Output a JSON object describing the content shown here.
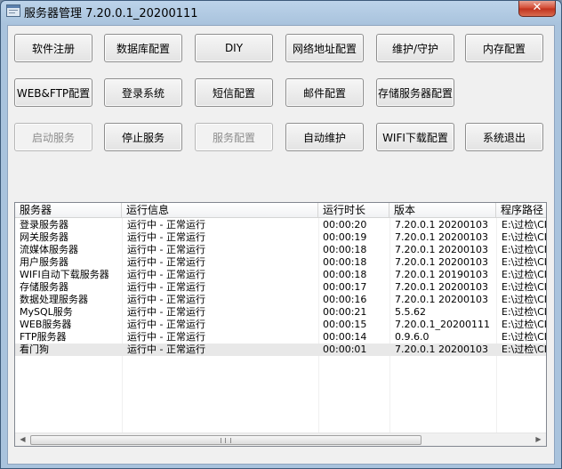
{
  "window": {
    "title": "服务器管理 7.20.0.1_20200111",
    "close_symbol": "✕",
    "icon": "app-window-icon"
  },
  "buttons": {
    "row1": [
      "软件注册",
      "数据库配置",
      "DIY",
      "网络地址配置",
      "维护/守护",
      "内存配置"
    ],
    "row2": [
      "WEB&FTP配置",
      "登录系统",
      "短信配置",
      "邮件配置",
      "存储服务器配置"
    ],
    "row3": [
      "启动服务",
      "停止服务",
      "服务配置",
      "自动维护",
      "WIFI下载配置",
      "系统退出"
    ]
  },
  "list": {
    "columns": [
      "服务器",
      "运行信息",
      "运行时长",
      "版本",
      "程序路径"
    ],
    "rows": [
      [
        "登录服务器",
        "运行中 - 正常运行",
        "00:00:20",
        "7.20.0.1 20200103",
        "E:\\过检\\CI"
      ],
      [
        "网关服务器",
        "运行中 - 正常运行",
        "00:00:19",
        "7.20.0.1 20200103",
        "E:\\过检\\CI"
      ],
      [
        "流媒体服务器",
        "运行中 - 正常运行",
        "00:00:18",
        "7.20.0.1 20200103",
        "E:\\过检\\CI"
      ],
      [
        "用户服务器",
        "运行中 - 正常运行",
        "00:00:18",
        "7.20.0.1 20200103",
        "E:\\过检\\CI"
      ],
      [
        "WIFI自动下载服务器",
        "运行中 - 正常运行",
        "00:00:18",
        "7.20.0.1 20190103",
        "E:\\过检\\CI"
      ],
      [
        "存储服务器",
        "运行中 - 正常运行",
        "00:00:17",
        "7.20.0.1 20200103",
        "E:\\过检\\CI"
      ],
      [
        "数据处理服务器",
        "运行中 - 正常运行",
        "00:00:16",
        "7.20.0.1 20200103",
        "E:\\过检\\CI"
      ],
      [
        "MySQL服务",
        "运行中 - 正常运行",
        "00:00:21",
        "5.5.62",
        "E:\\过检\\CI"
      ],
      [
        "WEB服务器",
        "运行中 - 正常运行",
        "00:00:15",
        "7.20.0.1_20200111",
        "E:\\过检\\CI"
      ],
      [
        "FTP服务器",
        "运行中 - 正常运行",
        "00:00:14",
        "0.9.6.0",
        "E:\\过检\\CI"
      ],
      [
        "看门狗",
        "运行中 - 正常运行",
        "00:00:01",
        "7.20.0.1 20200103",
        "E:\\过检\\CI"
      ]
    ],
    "selected_row": 10
  },
  "scrollbar": {
    "left_arrow": "◀",
    "right_arrow": "▶"
  }
}
